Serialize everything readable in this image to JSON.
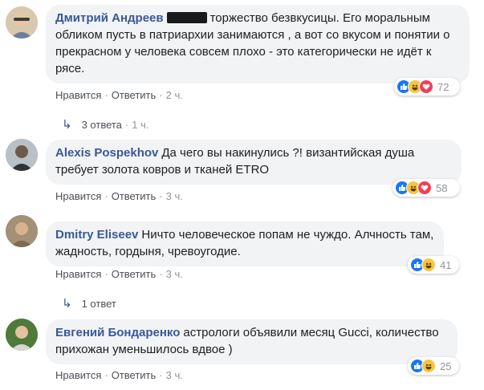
{
  "comments": [
    {
      "author": "Дмитрий Андреев",
      "text": "торжество безвкусицы. Его моральным обликом пусть в патриархии занимаются , а вот со вкусом и понятии о прекрасном у человека совсем плохо - это категорически не идёт к рясе.",
      "reaction_icons": [
        "like-icon",
        "haha-icon",
        "love-icon"
      ],
      "reaction_count": "72",
      "like_label": "Нравится",
      "reply_label": "Ответить",
      "time": "2 ч."
    },
    {
      "author": "Alexis Pospekhov",
      "text": "Да чего вы накинулись ?! византийская душа требует золота ковров и тканей ETRO",
      "reaction_icons": [
        "like-icon",
        "haha-icon",
        "love-icon"
      ],
      "reaction_count": "58",
      "like_label": "Нравится",
      "reply_label": "Ответить",
      "time": "3 ч."
    },
    {
      "author": "Dmitry Eliseev",
      "text": "Ничто человеческое попам не чуждо. Алчность там, жадность, гордыня, чревоугодие.",
      "reaction_icons": [
        "like-icon",
        "haha-icon"
      ],
      "reaction_count": "41",
      "like_label": "Нравится",
      "reply_label": "Ответить",
      "time": "3 ч."
    },
    {
      "author": "Евгений Бондаренко",
      "text": "астрологи объявили месяц Gucci, количество прихожан уменьшилось вдвое )",
      "reaction_icons": [
        "like-icon",
        "haha-icon"
      ],
      "reaction_count": "25",
      "like_label": "Нравится",
      "reply_label": "Ответить",
      "time": "3 ч."
    }
  ],
  "replies": [
    {
      "label": "3 ответа",
      "time": "1 ч."
    },
    {
      "label": "1 ответ"
    }
  ],
  "colors": {
    "author": "#385898",
    "bubble": "#f2f3f5",
    "like": "#1877f2",
    "haha": "#f7c640",
    "love": "#f33e58",
    "meta": "#90949c"
  }
}
